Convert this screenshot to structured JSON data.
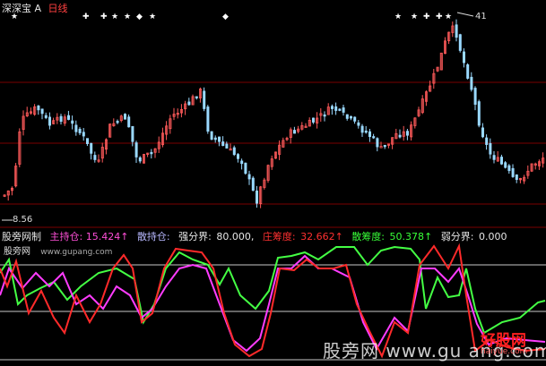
{
  "title_bar": {
    "app_name": "深深宝",
    "app_mark": "A",
    "period": "日线"
  },
  "price_pane": {
    "high_label": "41",
    "low_label": "8.56",
    "signal_row": [
      "★",
      "✚",
      "✚",
      "★",
      "★",
      "◆",
      "★",
      "◆",
      "★"
    ]
  },
  "indicator": {
    "name": "股旁网制",
    "main_label": "主持仓:",
    "main_value": "15.424↑",
    "dispersed_label": "散持仓:",
    "dispersed_value": "",
    "strong_label": "强分界:",
    "strong_value": "80.000,",
    "control_label": "庄筹度:",
    "control_value": "32.662↑",
    "scatter_label": "散筹度:",
    "scatter_value": "50.378↑",
    "weak_label": "弱分界:",
    "weak_value": "0.000"
  },
  "site_caption": {
    "name": "股旁网",
    "url": "www.gupang.com"
  },
  "watermark": "股旁网 www.gu   ang.com",
  "logo": {
    "mark": "好股网",
    "url": "haiyue.com"
  },
  "colors": {
    "up_candle": "#ff5a5a",
    "down_candle": "#9ad9ff",
    "main_line": "#ff3cff",
    "control_line": "#ff2a2a",
    "scatter_line": "#44ff44",
    "divider": "#c8c8c8"
  }
}
